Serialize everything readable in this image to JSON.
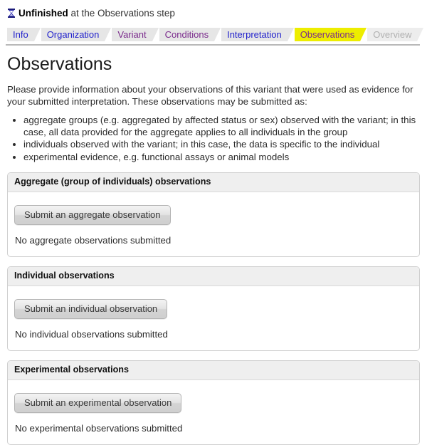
{
  "status": {
    "icon": "hourglass-icon",
    "state": "Unfinished",
    "rest": " at the Observations step"
  },
  "tabs": [
    {
      "label": "Info",
      "state": "link"
    },
    {
      "label": "Organization",
      "state": "link"
    },
    {
      "label": "Variant",
      "state": "visited"
    },
    {
      "label": "Conditions",
      "state": "visited"
    },
    {
      "label": "Interpretation",
      "state": "link"
    },
    {
      "label": "Observations",
      "state": "current"
    },
    {
      "label": "Overview",
      "state": "disabled"
    }
  ],
  "main": {
    "title": "Observations",
    "intro": "Please provide information about your observations of this variant that were used as evidence for your submitted interpretation. These observations may be submitted as:",
    "bullets": [
      "aggregate groups (e.g. aggregated by affected status or sex) observed with the variant; in this case, all data provided for the aggregate applies to all individuals in the group",
      "individuals observed with the variant; in this case, the data is specific to the individual",
      "experimental evidence, e.g. functional assays or animal models"
    ]
  },
  "panels": [
    {
      "header": "Aggregate (group of individuals) observations",
      "button": "Submit an aggregate observation",
      "empty": "No aggregate observations submitted"
    },
    {
      "header": "Individual observations",
      "button": "Submit an individual observation",
      "empty": "No individual observations submitted"
    },
    {
      "header": "Experimental observations",
      "button": "Submit an experimental observation",
      "empty": "No experimental observations submitted"
    }
  ],
  "colors": {
    "tab_link": "#2222cc",
    "tab_visited": "#7a2a8c",
    "tab_current_bg": "#eded00",
    "tab_disabled": "#b0b0b0",
    "panel_header_bg": "#efefef"
  }
}
